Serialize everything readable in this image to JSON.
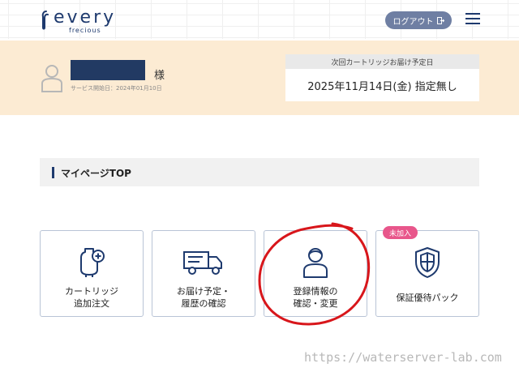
{
  "header": {
    "logo_text": "every",
    "logo_sub": "frecious",
    "logout_label": "ログアウト"
  },
  "account": {
    "honorific": "様",
    "service_start": "サービス開始日：2024年01月10日"
  },
  "delivery": {
    "heading": "次回カートリッジお届け予定日",
    "date": "2025年11月14日(金) 指定無し"
  },
  "page": {
    "title": "マイページTOP"
  },
  "cards": [
    {
      "label": "カートリッジ\n追加注文",
      "icon": "cartridge-add-icon"
    },
    {
      "label": "お届け予定・\n履歴の確認",
      "icon": "delivery-truck-icon"
    },
    {
      "label": "登録情報の\n確認・変更",
      "icon": "user-icon"
    },
    {
      "label": "保証優待パック",
      "icon": "shield-icon",
      "badge": "未加入"
    }
  ],
  "watermark": "https://waterserver-lab.com",
  "colors": {
    "navy": "#1e3a6e",
    "banner": "#fcebd3",
    "badge": "#e8568b",
    "annotation_red": "#d8161b"
  }
}
